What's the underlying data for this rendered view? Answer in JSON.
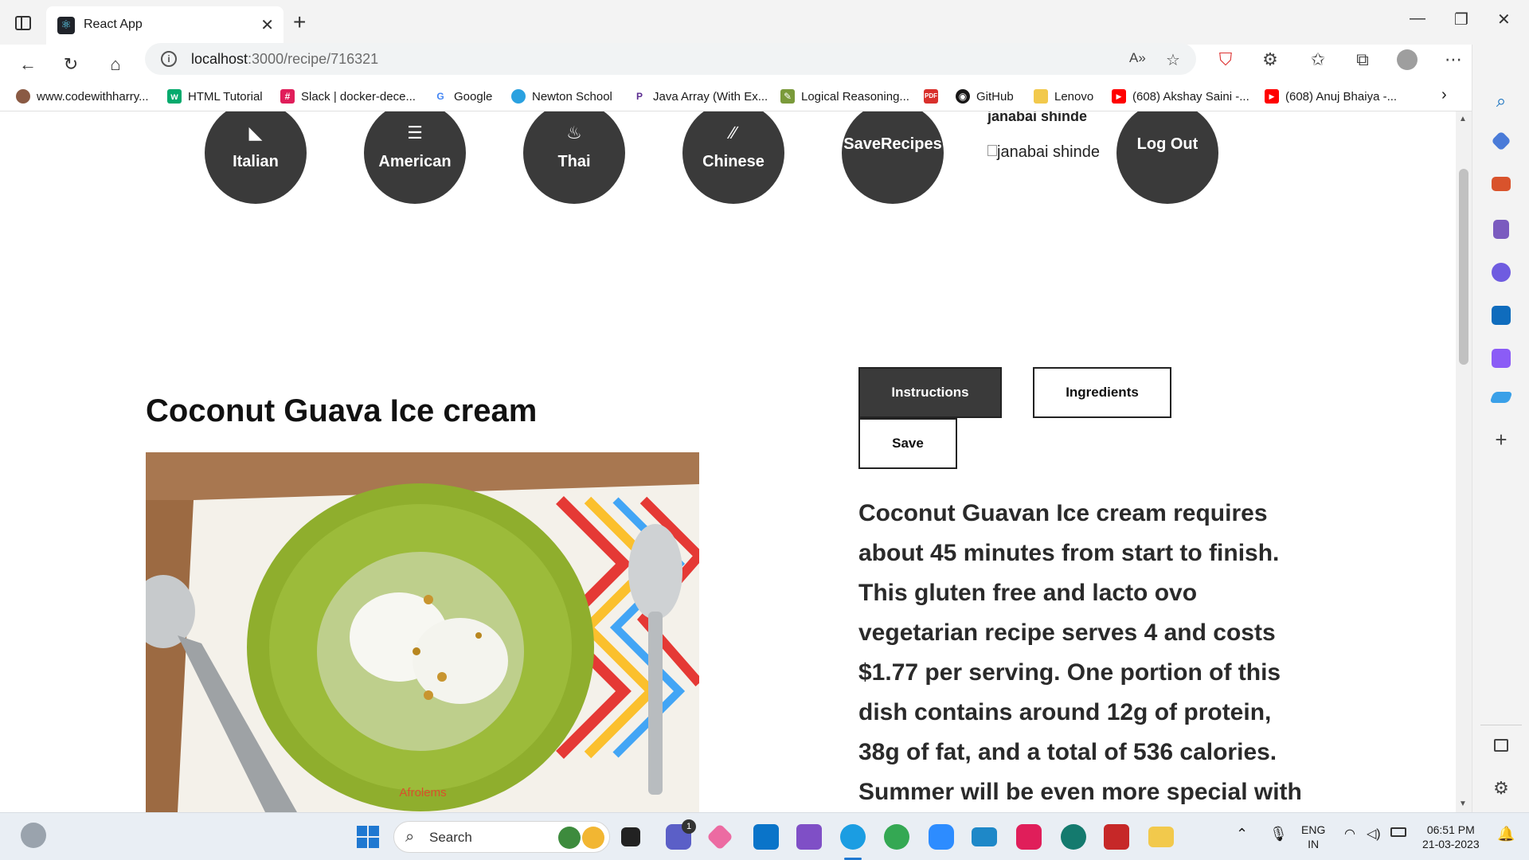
{
  "browser": {
    "tab_title": "React App",
    "url_host": "localhost",
    "url_rest": ":3000/recipe/716321",
    "read_aloud_label": "A»"
  },
  "bookmarks": [
    {
      "label": "www.codewithharry...",
      "icon": "avatar-icon",
      "color": "#8a5a44"
    },
    {
      "label": "HTML Tutorial",
      "icon": "w3schools-icon",
      "color": "#04aa6d"
    },
    {
      "label": "Slack | docker-dece...",
      "icon": "slack-icon",
      "color": "#e01e5a"
    },
    {
      "label": "Google",
      "icon": "google-icon",
      "color": "#4285f4"
    },
    {
      "label": "Newton School",
      "icon": "newton-icon",
      "color": "#2aa1e0"
    },
    {
      "label": "Java Array (With Ex...",
      "icon": "programiz-icon",
      "color": "#5c2d91"
    },
    {
      "label": "Logical Reasoning...",
      "icon": "indiabix-icon",
      "color": "#7a9a3a"
    },
    {
      "label": "",
      "icon": "pdf-icon",
      "color": "#d9302c"
    },
    {
      "label": "GitHub",
      "icon": "github-icon",
      "color": "#181717"
    },
    {
      "label": "Lenovo",
      "icon": "folder-icon",
      "color": "#f2c94c"
    },
    {
      "label": "(608) Akshay Saini -...",
      "icon": "youtube-icon",
      "color": "#ff0000"
    },
    {
      "label": "(608) Anuj Bhaiya -...",
      "icon": "youtube-icon",
      "color": "#ff0000"
    }
  ],
  "categories": [
    {
      "label": "Italian",
      "icon": "pizza-icon",
      "glyph": "◣"
    },
    {
      "label": "American",
      "icon": "burger-icon",
      "glyph": "☰"
    },
    {
      "label": "Thai",
      "icon": "noodles-icon",
      "glyph": "♨"
    },
    {
      "label": "Chinese",
      "icon": "chopsticks-icon",
      "glyph": "∕∕"
    },
    {
      "label": "SaveRecipes",
      "icon": "",
      "glyph": ""
    }
  ],
  "user": {
    "name": "janabai shinde",
    "avatar_alt": "janabai shinde",
    "logout_label": "Log Out"
  },
  "recipe": {
    "title": "Coconut Guava Ice cream",
    "image_watermark": "Afrolems",
    "tabs": {
      "instructions": "Instructions",
      "ingredients": "Ingredients",
      "save": "Save"
    },
    "summary": "Coconut Guavan Ice cream requires about 45 minutes from start to finish. This gluten free and lacto ovo vegetarian recipe serves 4 and costs $1.77 per serving. One portion of this dish contains around 12g of protein, 38g of fat, and a total of 536 calories. Summer will be even more special with"
  },
  "taskbar": {
    "search_label": "Search",
    "lang_line1": "ENG",
    "lang_line2": "IN",
    "time": "06:51 PM",
    "date": "21-03-2023",
    "chat_badge": "1"
  },
  "colors": {
    "accent_dark": "#3a3a3a",
    "edge_blue": "#0f6cbd"
  }
}
